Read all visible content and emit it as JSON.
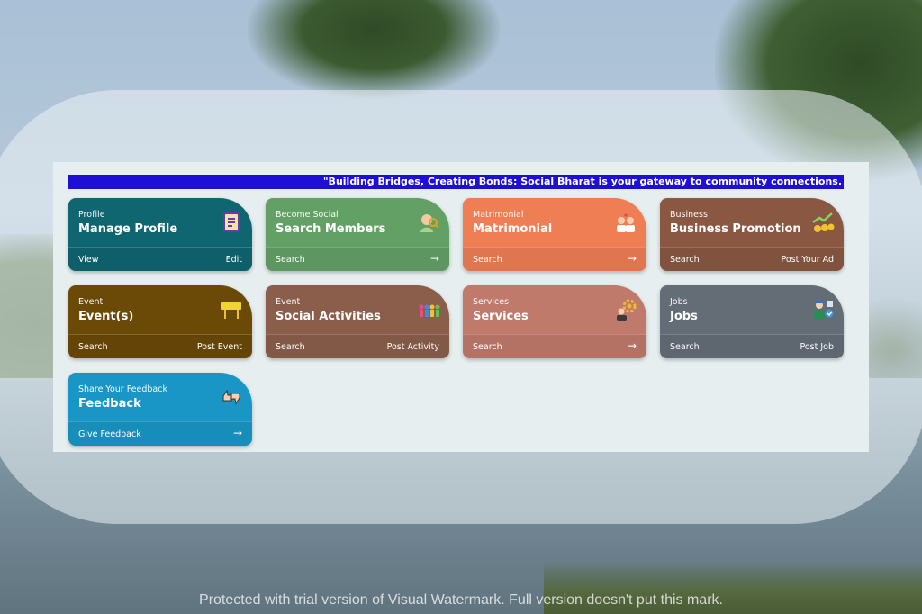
{
  "marquee_text": "\"Building Bridges, Creating Bonds: Social Bharat is your gateway to community connections.",
  "cards": [
    {
      "sub": "Profile",
      "title": "Manage Profile",
      "left_label": "View",
      "right_label": "Edit",
      "icon": "clipboard-icon",
      "color": "#0f6570"
    },
    {
      "sub": "Become Social",
      "title": "Search Members",
      "left_label": "Search",
      "right_label": "",
      "icon": "member-search-icon",
      "color": "#63a066"
    },
    {
      "sub": "Matrimonial",
      "title": "Matrimonial",
      "left_label": "Search",
      "right_label": "",
      "icon": "couple-icon",
      "color": "#ef7e55"
    },
    {
      "sub": "Business",
      "title": "Business Promotion",
      "left_label": "Search",
      "right_label": "Post Your Ad",
      "icon": "growth-chart-icon",
      "color": "#8a5842"
    },
    {
      "sub": "Event",
      "title": "Event(s)",
      "left_label": "Search",
      "right_label": "Post Event",
      "icon": "event-banner-icon",
      "color": "#6b4a08"
    },
    {
      "sub": "Event",
      "title": "Social Activities",
      "left_label": "Search",
      "right_label": "Post Activity",
      "icon": "people-group-icon",
      "color": "#8b5e4b"
    },
    {
      "sub": "Services",
      "title": "Services",
      "left_label": "Search",
      "right_label": "",
      "icon": "service-gear-icon",
      "color": "#c07a6c"
    },
    {
      "sub": "Jobs",
      "title": "Jobs",
      "left_label": "Search",
      "right_label": "Post Job",
      "icon": "worker-icon",
      "color": "#646d76"
    },
    {
      "sub": "Share Your Feedback",
      "title": "Feedback",
      "left_label": "Give Feedback",
      "right_label": "",
      "icon": "thumbs-feedback-icon",
      "color": "#1996c6"
    }
  ],
  "arrow_glyph": "→",
  "watermark": "Protected with trial version of Visual Watermark. Full version doesn't put this mark."
}
